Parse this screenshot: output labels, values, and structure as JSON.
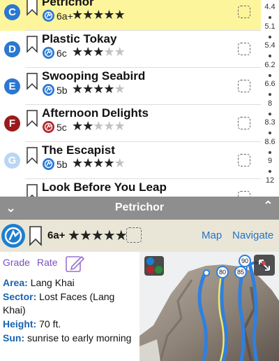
{
  "routes": [
    {
      "letter": "C",
      "name": "Petrichor",
      "grade": "6a+",
      "stars": 5,
      "letter_color": "#2a78d2",
      "grade_icon": "climber-icon",
      "selected": true
    },
    {
      "letter": "D",
      "name": "Plastic Tokay",
      "grade": "6c",
      "stars": 3,
      "letter_color": "#2a78d2",
      "grade_icon": "climber-icon",
      "selected": false
    },
    {
      "letter": "E",
      "name": "Swooping Seabird",
      "grade": "5b",
      "stars": 4,
      "letter_color": "#2a78d2",
      "grade_icon": "climber-icon",
      "selected": false
    },
    {
      "letter": "F",
      "name": "Afternoon Delights",
      "grade": "5c",
      "stars": 2,
      "letter_color": "#9a1b1b",
      "grade_icon": "climber-icon",
      "selected": false
    },
    {
      "letter": "G",
      "name": "The Escapist",
      "grade": "5b",
      "stars": 4,
      "letter_color": "#b9d6f2",
      "grade_icon": "climber-icon",
      "selected": false
    },
    {
      "letter": "",
      "name": "Look Before You Leap",
      "grade": "",
      "stars": 0,
      "letter_color": "#b9d6f2",
      "grade_icon": "",
      "selected": false
    }
  ],
  "index_bar": [
    "4.4",
    "5.1",
    "5.4",
    "6.2",
    "6.6",
    "8",
    "8.3",
    "8.6",
    "9",
    "12"
  ],
  "detail": {
    "title": "Petrichor",
    "grade": "6a+",
    "stars": 5,
    "map_label": "Map",
    "navigate_label": "Navigate",
    "tabs": {
      "grade": "Grade",
      "rate": "Rate"
    },
    "info": [
      {
        "label": "Area:",
        "value": "Lang Khai"
      },
      {
        "label": "Sector:",
        "value": "Lost Faces (Lang Khai)"
      },
      {
        "label": "Height:",
        "value": "70 ft."
      },
      {
        "label": "Sun:",
        "value": "sunrise to early morning"
      }
    ],
    "topo_markers": [
      "80",
      "85",
      "90"
    ]
  },
  "colors": {
    "selected_row": "#fdf59c",
    "accent_blue": "#2573c7",
    "header_gray": "#8e8e8e",
    "tab_purple": "#7c4fc2",
    "info_label_blue": "#1764b2",
    "topo_line_blue": "#2f80e0",
    "topo_line_yellow": "#f2e86a"
  }
}
